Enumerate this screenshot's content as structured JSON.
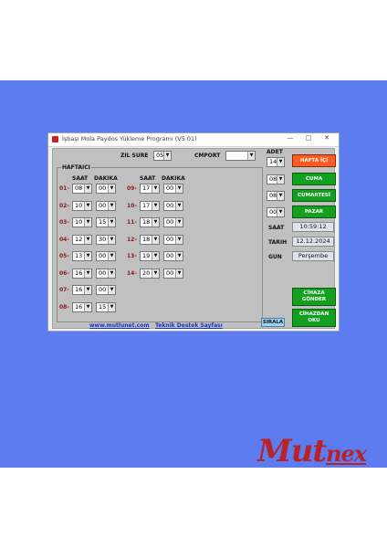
{
  "window": {
    "title": "İşbaşı Mola Paydos Yükleme Programı (V5.01)",
    "controls": [
      "—",
      "□",
      "✕"
    ]
  },
  "top": {
    "zil_sure_label": "ZIL SURE",
    "zil_sure_value": "05",
    "cmport_label": "CMPORT",
    "cmport_value": "",
    "adet_label": "ADET",
    "adet_value": "14"
  },
  "group": {
    "title": "HAFTAICI"
  },
  "headers": {
    "saat": "SAAT",
    "dakika": "DAKIKA"
  },
  "rows_left": [
    {
      "label": "01-",
      "hour": "08",
      "minute": "00"
    },
    {
      "label": "02-",
      "hour": "10",
      "minute": "00"
    },
    {
      "label": "03-",
      "hour": "10",
      "minute": "15"
    },
    {
      "label": "04-",
      "hour": "12",
      "minute": "30"
    },
    {
      "label": "05-",
      "hour": "13",
      "minute": "00"
    },
    {
      "label": "06-",
      "hour": "16",
      "minute": "00"
    },
    {
      "label": "07-",
      "hour": "16",
      "minute": "00"
    },
    {
      "label": "08-",
      "hour": "16",
      "minute": "15"
    }
  ],
  "rows_right": [
    {
      "label": "09-",
      "hour": "17",
      "minute": "00"
    },
    {
      "label": "10-",
      "hour": "17",
      "minute": "00"
    },
    {
      "label": "11-",
      "hour": "18",
      "minute": "00"
    },
    {
      "label": "12-",
      "hour": "18",
      "minute": "00"
    },
    {
      "label": "13-",
      "hour": "19",
      "minute": "00"
    },
    {
      "label": "14-",
      "hour": "20",
      "minute": "00"
    }
  ],
  "day_buttons": {
    "hafta_ici": "HAFTA İÇİ",
    "cuma": "CUMA",
    "cumartesi": "CUMARTESİ",
    "pazar": "PAZAR"
  },
  "day_counts": {
    "cuma": "08",
    "cumartesi": "08",
    "pazar": "00"
  },
  "info": {
    "saat_label": "SAAT",
    "saat_value": "10:59:12",
    "tarih_label": "TARIH",
    "tarih_value": "12.12.2024",
    "gun_label": "GUN",
    "gun_value": "Perşembe"
  },
  "actions": {
    "cihaza_gonder_1": "CİHAZA",
    "cihaza_gonder_2": "GÖNDER",
    "cihazdan_oku_1": "CİHAZDAN",
    "cihazdan_oku_2": "OKU",
    "sirala": "SIRALA"
  },
  "links": {
    "site": "www.mutlunet.com",
    "support": "Teknik Destek Sayfası"
  },
  "brand": {
    "logo_main": "Mut",
    "logo_tail": "nex"
  },
  "colors": {
    "background": "#5c7cf0",
    "hafta_ici": "#ff5a1f",
    "green": "#13a01e",
    "logo": "#b8232a"
  }
}
